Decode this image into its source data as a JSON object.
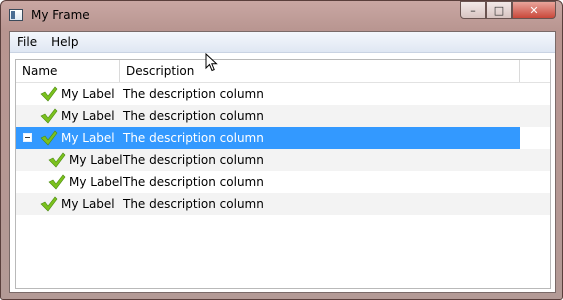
{
  "window": {
    "title": "My Frame",
    "controls": {
      "minimize": "–",
      "maximize": "□",
      "close": "✕"
    }
  },
  "menubar": {
    "items": [
      "File",
      "Help"
    ]
  },
  "tree": {
    "columns": [
      "Name",
      "Description"
    ],
    "rows": [
      {
        "name": "My Label",
        "description": "The description column",
        "level": 0,
        "selected": false,
        "expanded": null
      },
      {
        "name": "My Label",
        "description": "The description column",
        "level": 0,
        "selected": false,
        "expanded": null
      },
      {
        "name": "My Label",
        "description": "The description column",
        "level": 0,
        "selected": true,
        "expanded": true
      },
      {
        "name": "My Label",
        "description": "The description column",
        "level": 1,
        "selected": false,
        "expanded": null
      },
      {
        "name": "My Label",
        "description": "The description column",
        "level": 1,
        "selected": false,
        "expanded": null
      },
      {
        "name": "My Label",
        "description": "The description column",
        "level": 0,
        "selected": false,
        "expanded": null
      }
    ],
    "row_icon": "check-icon",
    "colors": {
      "selection": "#3399ff",
      "check": "#7bc11e",
      "alt_row": "#f3f3f3"
    }
  }
}
